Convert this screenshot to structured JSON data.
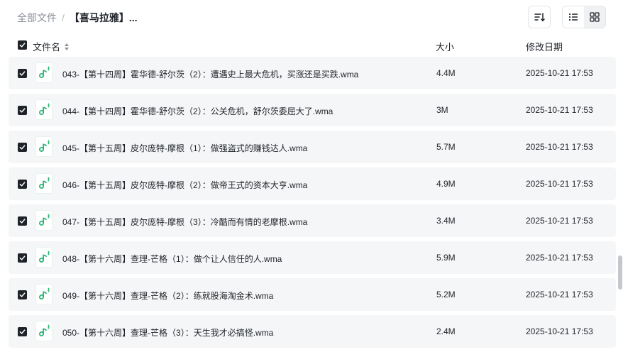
{
  "breadcrumb": {
    "root": "全部文件",
    "separator": "/",
    "current": "【喜马拉雅】..."
  },
  "icons": {
    "sort": "sort-icon",
    "list_view": "list-view-icon",
    "grid_view": "grid-view-icon",
    "file": "audio-file-icon",
    "checkbox": "checkbox-checked-icon"
  },
  "colors": {
    "audio_icon": "#2bb673",
    "row_bg": "#f5f6f7",
    "checkbox": "#1f2329"
  },
  "header": {
    "name": "文件名",
    "size": "大小",
    "modified": "修改日期"
  },
  "files": [
    {
      "name": "043-【第十四周】霍华德-舒尔茨（2）：遭遇史上最大危机，买涨还是买跌.wma",
      "size": "4.4M",
      "modified": "2025-10-21 17:53"
    },
    {
      "name": "044-【第十四周】霍华德-舒尔茨（2）：公关危机，舒尔茨委屈大了.wma",
      "size": "3M",
      "modified": "2025-10-21 17:53"
    },
    {
      "name": "045-【第十五周】皮尔庞特-摩根（1）：做强盗式的赚钱达人.wma",
      "size": "5.7M",
      "modified": "2025-10-21 17:53"
    },
    {
      "name": "046-【第十五周】皮尔庞特-摩根（2）：做帝王式的资本大亨.wma",
      "size": "4.9M",
      "modified": "2025-10-21 17:53"
    },
    {
      "name": "047-【第十五周】皮尔庞特-摩根（3）：冷酷而有情的老摩根.wma",
      "size": "3.4M",
      "modified": "2025-10-21 17:53"
    },
    {
      "name": "048-【第十六周】查理-芒格（1）：做个让人信任的人.wma",
      "size": "5.9M",
      "modified": "2025-10-21 17:53"
    },
    {
      "name": "049-【第十六周】查理-芒格（2）：练就股海淘金术.wma",
      "size": "5.2M",
      "modified": "2025-10-21 17:53"
    },
    {
      "name": "050-【第十六周】查理-芒格（3）：天生我才必搞怪.wma",
      "size": "2.4M",
      "modified": "2025-10-21 17:53"
    }
  ]
}
